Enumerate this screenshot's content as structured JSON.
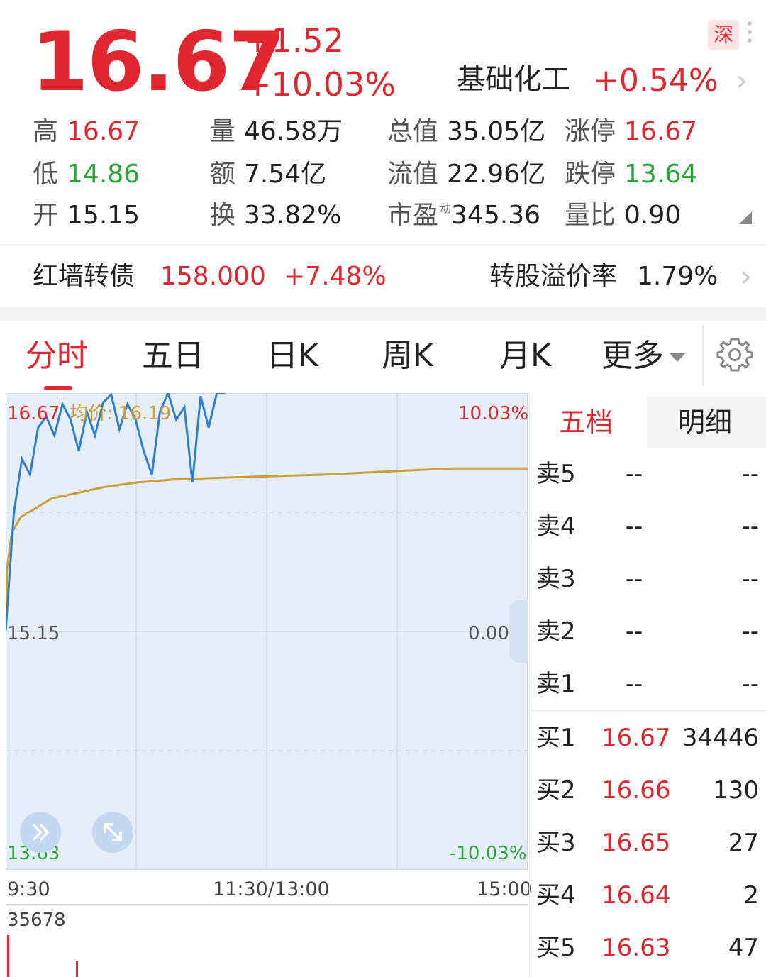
{
  "quote": {
    "price": "16.67",
    "change": "+1.52",
    "change_pct": "+10.03%",
    "market_badge": "深",
    "sector_name": "基础化工",
    "sector_change": "+0.54%"
  },
  "stats": {
    "high": {
      "label": "高",
      "value": "16.67"
    },
    "low": {
      "label": "低",
      "value": "14.86"
    },
    "open": {
      "label": "开",
      "value": "15.15"
    },
    "volume": {
      "label": "量",
      "value": "46.58万"
    },
    "amount": {
      "label": "额",
      "value": "7.54亿"
    },
    "turnover": {
      "label": "换",
      "value": "33.82%"
    },
    "total_cap": {
      "label": "总值",
      "value": "35.05亿"
    },
    "float_cap": {
      "label": "流值",
      "value": "22.96亿"
    },
    "pe": {
      "label": "市盈",
      "sup": "动",
      "value": "345.36"
    },
    "limit_up": {
      "label": "涨停",
      "value": "16.67"
    },
    "limit_down": {
      "label": "跌停",
      "value": "13.64"
    },
    "vol_ratio": {
      "label": "量比",
      "value": "0.90"
    }
  },
  "bond": {
    "name": "红墙转债",
    "price": "158.000",
    "change_pct": "+7.48%",
    "premium_label": "转股溢价率",
    "premium_value": "1.79%"
  },
  "tabs": [
    "分时",
    "五日",
    "日K",
    "周K",
    "月K",
    "更多"
  ],
  "chart": {
    "top_price": "16.67",
    "mid_price": "15.15",
    "bottom_price": "13.63",
    "top_pct": "10.03%",
    "mid_pct": "0.00%",
    "bottom_pct": "-10.03%",
    "avg_label": "均价: 16.19",
    "time_start": "9:30",
    "time_mid": "11:30/13:00",
    "time_end": "15:00",
    "volume_max": "35678",
    "colors": {
      "price_line": "#2f7fd0",
      "avg_line": "#c9a035",
      "grid": "#c3cfdd"
    }
  },
  "chart_data": {
    "type": "line",
    "x": [
      "9:30",
      "11:30/13:00",
      "15:00"
    ],
    "ylim": [
      13.63,
      16.67
    ],
    "series": [
      {
        "name": "",
        "values": [
          15.15,
          15.9,
          16.25,
          16.15,
          16.45,
          16.52,
          16.4,
          16.6,
          16.5,
          16.3,
          16.55,
          16.4,
          16.61,
          16.66,
          16.44,
          16.6,
          16.5,
          16.3,
          16.15,
          16.55,
          16.67,
          16.5,
          16.58,
          16.1,
          16.65,
          16.45,
          16.67,
          16.67
        ]
      },
      {
        "name": "均价",
        "values": [
          15.15,
          15.55,
          15.78,
          15.88,
          15.93,
          16.0,
          16.03,
          16.07,
          16.1,
          16.12,
          16.13,
          16.14,
          16.15,
          16.17,
          16.19,
          16.19
        ]
      }
    ]
  },
  "order_book": {
    "tabs": [
      "五档",
      "明细"
    ],
    "asks": [
      {
        "label": "卖5",
        "price": "--",
        "vol": "--"
      },
      {
        "label": "卖4",
        "price": "--",
        "vol": "--"
      },
      {
        "label": "卖3",
        "price": "--",
        "vol": "--"
      },
      {
        "label": "卖2",
        "price": "--",
        "vol": "--"
      },
      {
        "label": "卖1",
        "price": "--",
        "vol": "--"
      }
    ],
    "bids": [
      {
        "label": "买1",
        "price": "16.67",
        "vol": "34446"
      },
      {
        "label": "买2",
        "price": "16.66",
        "vol": "130"
      },
      {
        "label": "买3",
        "price": "16.65",
        "vol": "27"
      },
      {
        "label": "买4",
        "price": "16.64",
        "vol": "2"
      },
      {
        "label": "买5",
        "price": "16.63",
        "vol": "47"
      }
    ]
  }
}
